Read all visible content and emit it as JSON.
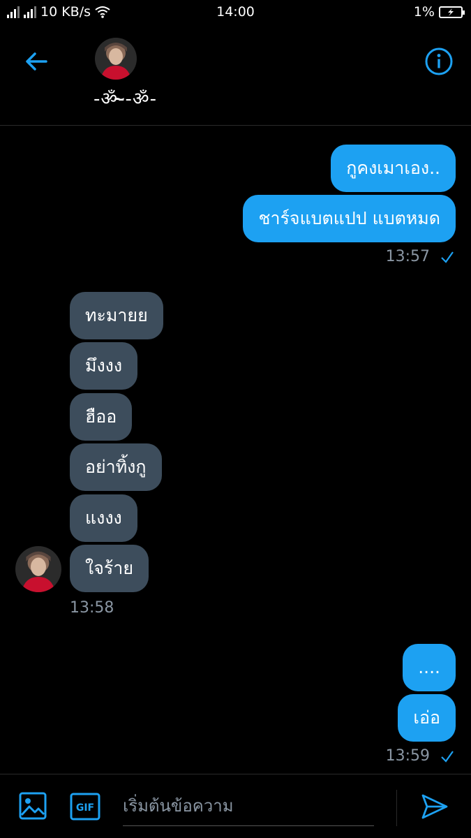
{
  "status_bar": {
    "net_speed": "10 KB/s",
    "time": "14:00",
    "battery": "1%"
  },
  "header": {
    "contact_name": "-ॐ-̴̴̴̴̴̴̴̴̴̴̴̴̴̴̴̴̴̴̴̴̴̴̴̴̴̴̴̴̴̴̴̴̴̴̴̴̴̴̴̴̴̴̴̴̴̴̴̴̴̴̴̴̴̴̴̴̴̴̴̴̴̴̴̴̴̴̴̴̴̴̴̴̴̴̴̴̴̴̴̴̴̴̴̴̴̴̴̴̴̴̴̴̴̴̴̴-ॐ-"
  },
  "messages": {
    "out1": "กูคงเมาเอง..",
    "out2": "ชาร์จแบตแปป แบตหมด",
    "out_time1": "13:57",
    "in1": "ทะมายย",
    "in2": "มึงงง",
    "in3": "ฮืออ",
    "in4": "อย่าทิ้งกู",
    "in5": "แงงง",
    "in6": "ใจร้าย",
    "in_time": "13:58",
    "out3": "....",
    "out4": "เอ่อ",
    "out_time2": "13:59"
  },
  "composer": {
    "placeholder": "เริ่มต้นข้อความ",
    "gif_label": "GIF"
  },
  "colors": {
    "accent": "#1da1f2",
    "incoming_bubble": "#3d4d5c",
    "background": "#000000"
  }
}
